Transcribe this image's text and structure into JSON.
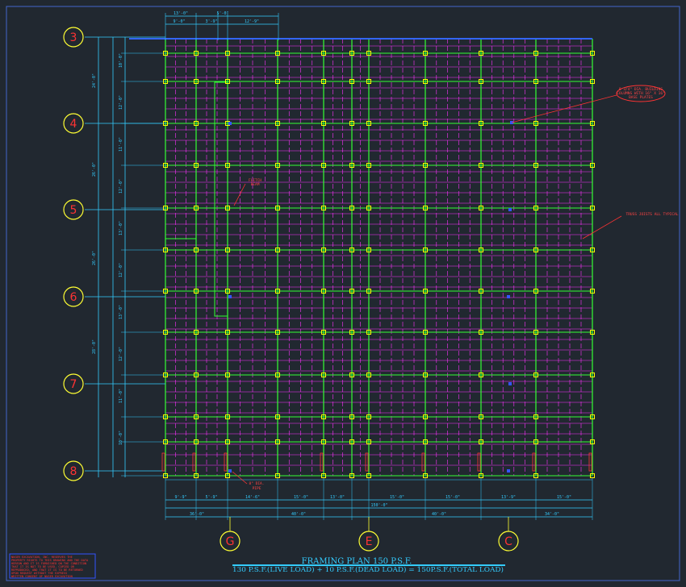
{
  "drawing": {
    "title": "FRAMING  PLAN 150 P.S.F.",
    "subtitle": "130  P.S.F.(LIVE  LOAD)  +  10  P.S.F.(DEAD  LOAD)  =  150P.S.F.(TOTAL  LOAD)",
    "row_labels": [
      "3",
      "4",
      "5",
      "6",
      "7",
      "8"
    ],
    "col_labels": [
      "G",
      "E",
      "C"
    ],
    "top_dims": [
      "13'-0\"",
      "5'-0\"",
      "9'-0\"",
      "3'-9\"",
      "12'-9\""
    ],
    "left_outer_dims": [
      "24'-0\"",
      "26'-0\"",
      "26'-0\"",
      "28'-0\""
    ],
    "left_inner_dims": [
      "10'-0\"",
      "12'-0\"",
      "11'-0\"",
      "12'-0\"",
      "13'-0\"",
      "12'-0\"",
      "13'-0\"",
      "12'-0\"",
      "11'-0\"",
      "10'-0\""
    ],
    "bottom_bay_dims": [
      "9'-9\"",
      "5'-9\"",
      "14'-6\"",
      "15'-0\"",
      "13'-0\"",
      "15'-0\"",
      "15'-0\"",
      "13'-9\"",
      "15'-0\""
    ],
    "bottom_group_dims": [
      "36'-0\"",
      "40'-0\"",
      "40'-0\"",
      "34'-0\""
    ],
    "bottom_total": "150'-0\"",
    "notes": [
      {
        "name": "note-base-plates",
        "lines": [
          "8 3/4\" DIA. BUILDING",
          "COLUMNS WITH 16\" X 16\"",
          "BASE PLATES"
        ]
      },
      {
        "name": "note-joists",
        "lines": [
          "TRUSS JOISTS ALL TYPICAL"
        ]
      },
      {
        "name": "note-pipe",
        "lines": [
          "8\" DIA.",
          "PIPE"
        ]
      },
      {
        "name": "note-beam",
        "lines": [
          "FLITCH",
          "BEAM"
        ]
      }
    ],
    "stamp_lines": [
      "NUGER EXCAVATION, INC. RESERVES THE",
      "PROPERTY RIGHTS TO THIS DRAWING AND THE DATA",
      "HEREON AND IT IS FURNISHED ON THE CONDITION",
      "THAT IT IS NOT TO BE USED, COPIED OR",
      "REPRODUCED, AND THAT IT IS TO BE RETURNED",
      "UPON REQUEST WITHOUT THE EXPRESS",
      "WRITTEN CONSENT OF NUGER EXCAVATION"
    ],
    "colors": {
      "background": "#212830",
      "grid": "#33ff33",
      "joists": "#ff33ff",
      "dims": "#33ccff",
      "labels": "#ffff33",
      "notes": "#ff3333",
      "nodes": "#ffff00"
    }
  }
}
